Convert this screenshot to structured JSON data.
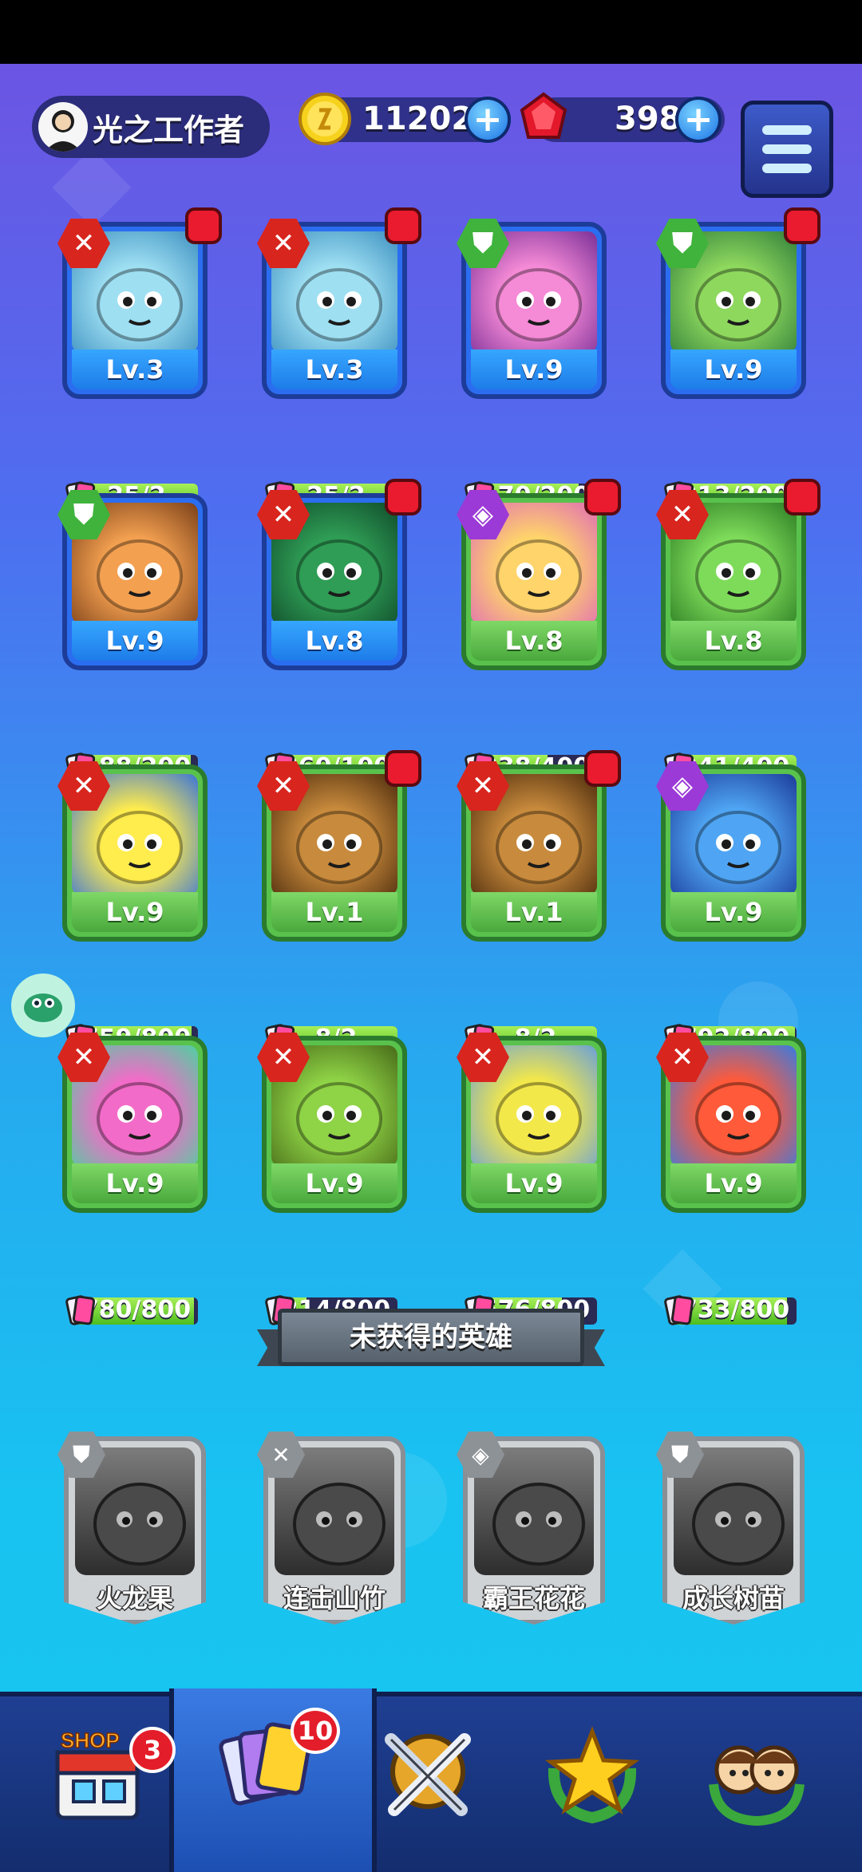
{
  "header": {
    "player_name": "光之工作者",
    "coins": "11202",
    "gems": "398",
    "plus": "+",
    "menu_icon": "hamburger-menu-icon"
  },
  "owned_heroes": [
    {
      "level": "Lv.3",
      "progress": "25/2",
      "fill": 1.0,
      "class": "sword",
      "frame": "blue",
      "dot": true
    },
    {
      "level": "Lv.3",
      "progress": "25/2",
      "fill": 1.0,
      "class": "sword",
      "frame": "blue",
      "dot": true
    },
    {
      "level": "Lv.9",
      "progress": "170/200",
      "fill": 0.85,
      "class": "guard",
      "frame": "blue",
      "dot": false
    },
    {
      "level": "Lv.9",
      "progress": "213/200",
      "fill": 1.0,
      "class": "guard",
      "frame": "blue",
      "dot": true
    },
    {
      "level": "Lv.9",
      "progress": "188/200",
      "fill": 0.94,
      "class": "guard",
      "frame": "blue",
      "dot": false
    },
    {
      "level": "Lv.8",
      "progress": "360/100",
      "fill": 1.0,
      "class": "sword",
      "frame": "blue",
      "dot": true
    },
    {
      "level": "Lv.8",
      "progress": "238/400",
      "fill": 0.6,
      "class": "magic",
      "frame": "green",
      "dot": true
    },
    {
      "level": "Lv.8",
      "progress": "041/400",
      "fill": 1.0,
      "class": "sword",
      "frame": "green",
      "dot": true
    },
    {
      "level": "Lv.9",
      "progress": "759/800",
      "fill": 0.95,
      "class": "sword",
      "frame": "green",
      "dot": false
    },
    {
      "level": "Lv.1",
      "progress": "8/2",
      "fill": 1.0,
      "class": "sword",
      "frame": "green",
      "dot": true
    },
    {
      "level": "Lv.1",
      "progress": "8/2",
      "fill": 1.0,
      "class": "sword",
      "frame": "green",
      "dot": true
    },
    {
      "level": "Lv.9",
      "progress": "792/800",
      "fill": 0.99,
      "class": "magic",
      "frame": "green",
      "dot": false
    },
    {
      "level": "Lv.9",
      "progress": "780/800",
      "fill": 0.97,
      "class": "sword",
      "frame": "green",
      "dot": false
    },
    {
      "level": "Lv.9",
      "progress": "214/800",
      "fill": 0.27,
      "class": "sword",
      "frame": "green",
      "dot": false
    },
    {
      "level": "Lv.9",
      "progress": "576/800",
      "fill": 0.72,
      "class": "sword",
      "frame": "green",
      "dot": false
    },
    {
      "level": "Lv.9",
      "progress": "733/800",
      "fill": 0.92,
      "class": "sword",
      "frame": "green",
      "dot": false
    }
  ],
  "locked_section_title": "未获得的英雄",
  "locked_heroes": [
    {
      "name": "火龙果",
      "class": "guard"
    },
    {
      "name": "连击山竹",
      "class": "sword"
    },
    {
      "name": "霸王花花",
      "class": "magic"
    },
    {
      "name": "成长树苗",
      "class": "guard"
    }
  ],
  "bottom_nav": {
    "shop_label": "SHOP",
    "shop_badge": "3",
    "cards_badge": "10",
    "items": [
      "shop",
      "cards",
      "battle",
      "achievements",
      "social"
    ]
  },
  "colors": {
    "accent_red": "#e41d2a",
    "progress_green": "#4cbd20",
    "blue_frame": "#2b6df0",
    "green_frame": "#59c24d"
  }
}
